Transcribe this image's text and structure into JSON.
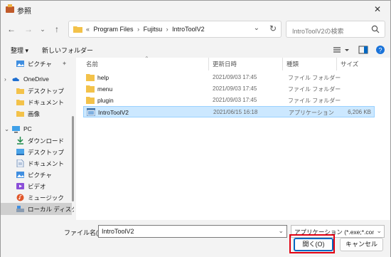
{
  "window": {
    "title": "参照",
    "close_glyph": "✕"
  },
  "nav": {
    "back": "←",
    "forward": "→",
    "recent": "⌄",
    "up": "↑"
  },
  "address": {
    "overflow": "«",
    "crumbs": [
      "Program Files",
      "Fujitsu",
      "IntroToolV2"
    ],
    "separator": "›",
    "dropdown": "⌄",
    "refresh": "↻"
  },
  "search": {
    "placeholder": "IntroToolV2の検索"
  },
  "toolbar": {
    "organize": "整理 ▾",
    "new_folder": "新しいフォルダー"
  },
  "sidebar": {
    "items": [
      {
        "label": "ピクチャ",
        "icon": "pictures-icon",
        "pin": true
      },
      {
        "label": "OneDrive",
        "icon": "cloud-icon"
      },
      {
        "label": "デスクトップ",
        "icon": "folder-icon"
      },
      {
        "label": "ドキュメント",
        "icon": "folder-icon"
      },
      {
        "label": "画像",
        "icon": "folder-icon"
      },
      {
        "label": "PC",
        "icon": "pc-icon"
      },
      {
        "label": "ダウンロード",
        "icon": "download-icon"
      },
      {
        "label": "デスクトップ",
        "icon": "desktop-icon"
      },
      {
        "label": "ドキュメント",
        "icon": "documents-icon"
      },
      {
        "label": "ピクチャ",
        "icon": "pictures-icon"
      },
      {
        "label": "ビデオ",
        "icon": "video-icon"
      },
      {
        "label": "ミュージック",
        "icon": "music-icon"
      },
      {
        "label": "ローカル ディスク (C",
        "icon": "drive-icon",
        "selected": true
      }
    ]
  },
  "columns": {
    "name": "名前",
    "modified": "更新日時",
    "type": "種類",
    "size": "サイズ"
  },
  "files": [
    {
      "name": "help",
      "date": "2021/09/03 17:45",
      "type": "ファイル フォルダー",
      "size": "",
      "kind": "folder"
    },
    {
      "name": "menu",
      "date": "2021/09/03 17:45",
      "type": "ファイル フォルダー",
      "size": "",
      "kind": "folder"
    },
    {
      "name": "plugin",
      "date": "2021/09/03 17:45",
      "type": "ファイル フォルダー",
      "size": "",
      "kind": "folder"
    },
    {
      "name": "IntroToolV2",
      "date": "2021/06/15 16:18",
      "type": "アプリケーション",
      "size": "6,206 KB",
      "kind": "app",
      "selected": true
    }
  ],
  "footer": {
    "filename_label": "ファイル名(N):",
    "filename_value": "IntroToolV2",
    "filetype_value": "アプリケーション (*.exe;*.com;*.icd",
    "dropdown": "⌄",
    "open_label": "開く(O)",
    "cancel_label": "キャンセル"
  },
  "colors": {
    "highlight": "#e00012",
    "selection": "#cce8ff",
    "accent": "#0067c0"
  }
}
